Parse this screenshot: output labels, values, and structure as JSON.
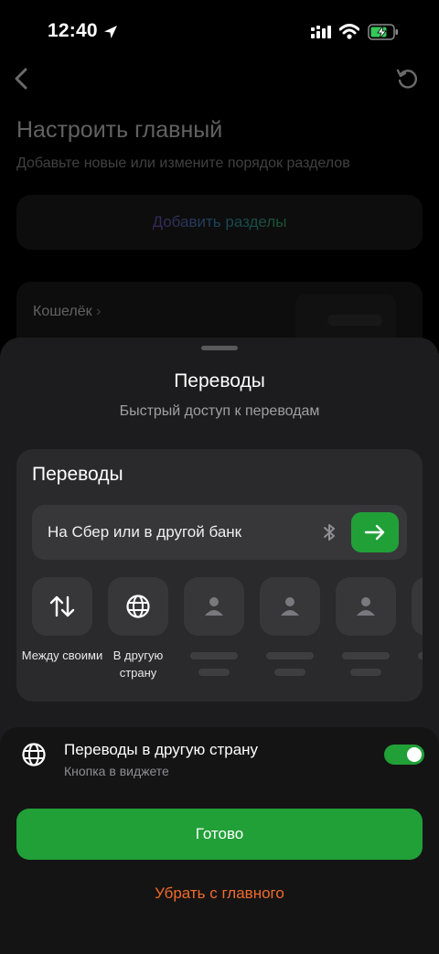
{
  "status_bar": {
    "time": "12:40"
  },
  "background": {
    "title": "Настроить главный",
    "subtitle": "Добавьте новые или измените порядок разделов",
    "add_sections": "Добавить разделы",
    "wallet_label": "Кошелёк",
    "wallet_chevron": "›"
  },
  "sheet": {
    "title": "Переводы",
    "subtitle": "Быстрый доступ к переводам",
    "preview": {
      "title": "Переводы",
      "transfer_label": "На Сбер или в другой банк",
      "quick": [
        {
          "icon": "arrows-up-down-icon",
          "label": "Между своими"
        },
        {
          "icon": "globe-icon",
          "label": "В другую страну"
        },
        {
          "icon": "person-icon",
          "label": ""
        },
        {
          "icon": "person-icon",
          "label": ""
        },
        {
          "icon": "person-icon",
          "label": ""
        }
      ]
    },
    "setting": {
      "title": "Переводы в другую страну",
      "subtitle": "Кнопка в виджете",
      "toggle_on": true
    },
    "done_label": "Готово",
    "remove_label": "Убрать с главного"
  },
  "colors": {
    "accent": "#21a038",
    "danger": "#ef6a2c",
    "sheet_bg": "#1c1c1e"
  }
}
